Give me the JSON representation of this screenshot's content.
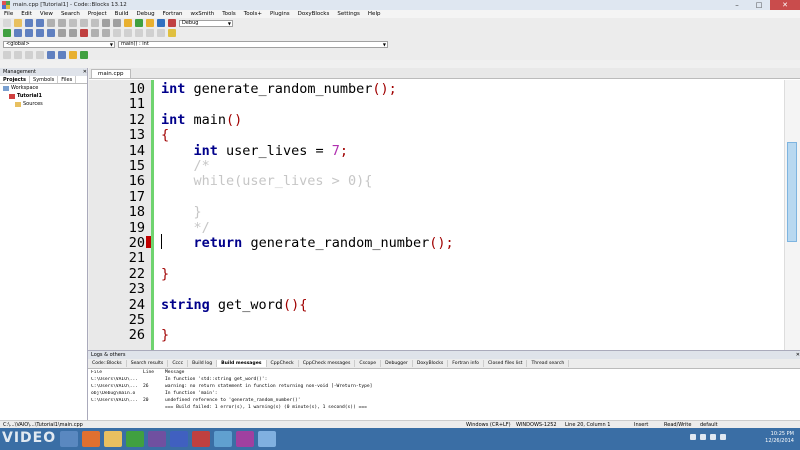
{
  "window": {
    "title": "main.cpp [Tutorial1] - Code::Blocks 13.12"
  },
  "menu": [
    "File",
    "Edit",
    "View",
    "Search",
    "Project",
    "Build",
    "Debug",
    "Fortran",
    "wxSmith",
    "Tools",
    "Tools+",
    "Plugins",
    "DoxyBlocks",
    "Settings",
    "Help"
  ],
  "toolbar": {
    "build_target": "Debug",
    "scope": "<global>",
    "function": "main() : int"
  },
  "management": {
    "title": "Management",
    "tabs": [
      "Projects",
      "Symbols",
      "Files"
    ],
    "tree": [
      "Workspace",
      "Tutorial1",
      "Sources"
    ]
  },
  "editor": {
    "tab": "main.cpp",
    "lines": [
      {
        "n": "10",
        "tokens": [
          [
            "kw",
            "int"
          ],
          [
            "",
            "generate_random_number"
          ],
          [
            "br",
            "();"
          ]
        ]
      },
      {
        "n": "11",
        "tokens": []
      },
      {
        "n": "12",
        "tokens": [
          [
            "kw",
            "int"
          ],
          [
            "",
            "main"
          ],
          [
            "br",
            "()"
          ]
        ]
      },
      {
        "n": "13",
        "tokens": [
          [
            "br",
            "{"
          ]
        ]
      },
      {
        "n": "14",
        "tokens": [
          [
            "",
            "    "
          ],
          [
            "kw",
            "int"
          ],
          [
            "",
            "user_lives = "
          ],
          [
            "nm",
            "7"
          ],
          [
            "br",
            ";"
          ]
        ]
      },
      {
        "n": "15",
        "tokens": [
          [
            "",
            "    "
          ],
          [
            "cm",
            "/*"
          ]
        ]
      },
      {
        "n": "16",
        "tokens": [
          [
            "",
            "    "
          ],
          [
            "cm",
            "while(user_lives > 0){"
          ]
        ]
      },
      {
        "n": "17",
        "tokens": []
      },
      {
        "n": "18",
        "tokens": [
          [
            "",
            "    "
          ],
          [
            "cm",
            "}"
          ]
        ]
      },
      {
        "n": "19",
        "tokens": [
          [
            "",
            "    "
          ],
          [
            "cm",
            "*/"
          ]
        ]
      },
      {
        "n": "20",
        "tokens": [
          [
            "",
            "    "
          ],
          [
            "kw",
            "return"
          ],
          [
            "",
            "generate_random_number"
          ],
          [
            "br",
            "();"
          ]
        ]
      },
      {
        "n": "21",
        "tokens": []
      },
      {
        "n": "22",
        "tokens": [
          [
            "br",
            "}"
          ]
        ]
      },
      {
        "n": "23",
        "tokens": []
      },
      {
        "n": "24",
        "tokens": [
          [
            "kw",
            "string"
          ],
          [
            "",
            "get_word"
          ],
          [
            "br",
            "(){"
          ]
        ]
      },
      {
        "n": "25",
        "tokens": []
      },
      {
        "n": "26",
        "tokens": [
          [
            "br",
            "}"
          ]
        ]
      }
    ]
  },
  "logs": {
    "title": "Logs & others",
    "tabs": [
      "Code::Blocks",
      "Search results",
      "Cccc",
      "Build log",
      "Build messages",
      "CppCheck",
      "CppCheck messages",
      "Cscope",
      "Debugger",
      "DoxyBlocks",
      "Fortran info",
      "Closed files list",
      "Thread search"
    ],
    "columns": [
      "File",
      "Line",
      "Message"
    ],
    "rows": [
      [
        "C:\\Users\\VAIO\\...",
        "",
        "In function 'std::string get_word()':"
      ],
      [
        "C:\\Users\\VAIO\\...",
        "26",
        "warning: no return statement in function returning non-void [-Wreturn-type]"
      ],
      [
        "obj\\Debug\\main.o",
        "",
        "In function 'main':"
      ],
      [
        "C:\\Users\\VAIO\\...",
        "20",
        "undefined reference to 'generate_random_number()'"
      ],
      [
        "",
        "",
        "=== Build failed: 1 error(s), 1 warning(s) (0 minute(s), 1 second(s)) ==="
      ]
    ]
  },
  "status": {
    "path": "C:\\...\\VAIO\\...\\Tutorial1\\main.cpp",
    "eol": "Windows (CR+LF)",
    "encoding": "WINDOWS-1252",
    "position": "Line 20, Column 1",
    "mode": "Insert",
    "rw": "Read/Write",
    "profile": "default"
  },
  "taskbar": {
    "watermark": "VIDEO",
    "time": "10:25 PM",
    "date": "12/26/2014"
  },
  "colors": {
    "accent": "#3a6ea5",
    "keyword": "#00008b",
    "comment": "#c6c6c6",
    "breakpoint": "#c00000"
  }
}
